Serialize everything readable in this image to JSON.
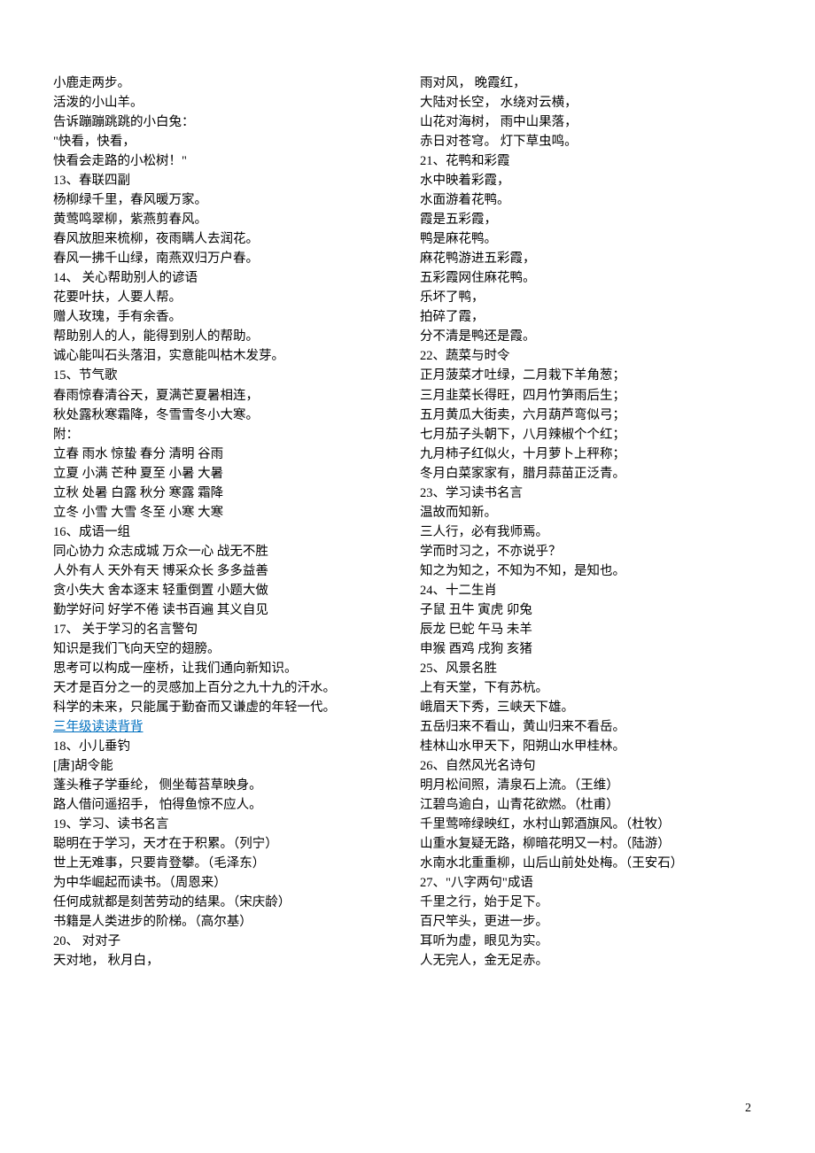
{
  "left": [
    {
      "t": "小鹿走两步。"
    },
    {
      "t": "活泼的小山羊。"
    },
    {
      "t": "告诉蹦蹦跳跳的小白兔："
    },
    {
      "t": "\"快看，快看，"
    },
    {
      "t": "快看会走路的小松树！\""
    },
    {
      "t": "13、春联四副"
    },
    {
      "t": "杨柳绿千里，春风暖万家。"
    },
    {
      "t": "黄莺鸣翠柳，紫燕剪春风。"
    },
    {
      "t": "春风放胆来梳柳，夜雨瞒人去润花。"
    },
    {
      "t": "春风一拂千山绿，南燕双归万户春。"
    },
    {
      "t": "14、  关心帮助别人的谚语"
    },
    {
      "t": "花要叶扶，人要人帮。"
    },
    {
      "t": "赠人玫瑰，手有余香。"
    },
    {
      "t": "帮助别人的人，能得到别人的帮助。"
    },
    {
      "t": "诚心能叫石头落泪，实意能叫枯木发芽。"
    },
    {
      "t": "15、节气歌"
    },
    {
      "t": "春雨惊春清谷天，夏满芒夏暑相连，"
    },
    {
      "t": "秋处露秋寒霜降，冬雪雪冬小大寒。"
    },
    {
      "t": "附："
    },
    {
      "t": "立春  雨水  惊蛰  春分  清明  谷雨"
    },
    {
      "t": "立夏  小满  芒种  夏至  小暑  大暑"
    },
    {
      "t": "立秋  处暑  白露  秋分  寒露  霜降"
    },
    {
      "t": "立冬  小雪  大雪  冬至  小寒  大寒"
    },
    {
      "t": "16、成语一组"
    },
    {
      "t": "同心协力    众志成城    万众一心    战无不胜"
    },
    {
      "t": "人外有人    天外有天    博采众长    多多益善"
    },
    {
      "t": "贪小失大    舍本逐末    轻重倒置    小题大做"
    },
    {
      "t": "勤学好问    好学不倦    读书百遍    其义自见"
    },
    {
      "t": "17、  关于学习的名言警句"
    },
    {
      "t": "知识是我们飞向天空的翅膀。"
    },
    {
      "t": "思考可以构成一座桥，让我们通向新知识。"
    },
    {
      "t": "天才是百分之一的灵感加上百分之九十九的汗水。"
    },
    {
      "t": "科学的未来，只能属于勤奋而又谦虚的年轻一代。"
    },
    {
      "t": "三年级读读背背",
      "link": true
    },
    {
      "t": "18、小儿垂钓"
    },
    {
      "t": "[唐]胡令能"
    },
    {
      "t": "蓬头稚子学垂纶，    侧坐莓苔草映身。"
    },
    {
      "t": "路人借问遥招手，    怕得鱼惊不应人。"
    },
    {
      "t": "19、学习、读书名言"
    },
    {
      "t": "聪明在于学习，天才在于积累。（列宁）"
    },
    {
      "t": "世上无难事，只要肯登攀。（毛泽东）"
    },
    {
      "t": "为中华崛起而读书。（周恩来）"
    },
    {
      "t": "任何成就都是刻苦劳动的结果。（宋庆龄）"
    },
    {
      "t": "书籍是人类进步的阶梯。（高尔基）"
    },
    {
      "t": "20、  对对子"
    },
    {
      "t": "天对地，                    秋月白，"
    }
  ],
  "right": [
    {
      "t": "雨对风，                    晚霞红，"
    },
    {
      "t": "大陆对长空，            水绕对云横，"
    },
    {
      "t": "山花对海树，            雨中山果落，"
    },
    {
      "t": "赤日对苍穹。            灯下草虫鸣。"
    },
    {
      "t": "21、花鸭和彩霞"
    },
    {
      "t": "水中映着彩霞，"
    },
    {
      "t": "水面游着花鸭。"
    },
    {
      "t": "霞是五彩霞，"
    },
    {
      "t": "鸭是麻花鸭。"
    },
    {
      "t": "麻花鸭游进五彩霞，"
    },
    {
      "t": "五彩霞网住麻花鸭。"
    },
    {
      "t": "乐坏了鸭，"
    },
    {
      "t": "拍碎了霞，"
    },
    {
      "t": "分不清是鸭还是霞。"
    },
    {
      "t": "22、蔬菜与时令"
    },
    {
      "t": "正月菠菜才吐绿，二月栽下羊角葱；"
    },
    {
      "t": "三月韭菜长得旺，四月竹笋雨后生；"
    },
    {
      "t": "五月黄瓜大街卖，六月葫芦弯似弓；"
    },
    {
      "t": "七月茄子头朝下，八月辣椒个个红；"
    },
    {
      "t": "九月柿子红似火，十月萝卜上秤称；"
    },
    {
      "t": "冬月白菜家家有，腊月蒜苗正泛青。"
    },
    {
      "t": "23、学习读书名言"
    },
    {
      "t": "温故而知新。"
    },
    {
      "t": "三人行，必有我师焉。"
    },
    {
      "t": "学而时习之，不亦说乎？"
    },
    {
      "t": "知之为知之，不知为不知，是知也。"
    },
    {
      "t": "24、十二生肖"
    },
    {
      "t": "子鼠        丑牛        寅虎        卯兔"
    },
    {
      "t": "辰龙        巳蛇        午马        未羊"
    },
    {
      "t": "申猴        酉鸡        戌狗        亥猪"
    },
    {
      "t": "25、风景名胜"
    },
    {
      "t": "上有天堂，下有苏杭。"
    },
    {
      "t": "峨眉天下秀，三峡天下雄。"
    },
    {
      "t": "五岳归来不看山，黄山归来不看岳。"
    },
    {
      "t": "桂林山水甲天下，阳朔山水甲桂林。"
    },
    {
      "t": "26、自然风光名诗句"
    },
    {
      "t": "明月松间照，清泉石上流。（王维）"
    },
    {
      "t": "江碧鸟逾白，山青花欲燃。（杜甫）"
    },
    {
      "t": "千里莺啼绿映红，水村山郭酒旗风。（杜牧）"
    },
    {
      "t": "山重水复疑无路，柳暗花明又一村。（陆游）"
    },
    {
      "t": "水南水北重重柳，山后山前处处梅。（王安石）"
    },
    {
      "t": "27、\"八字两句\"成语"
    },
    {
      "t": "千里之行，始于足下。"
    },
    {
      "t": "百尺竿头，更进一步。"
    },
    {
      "t": "耳听为虚，眼见为实。"
    },
    {
      "t": "人无完人，金无足赤。"
    }
  ],
  "pagenum": "2"
}
